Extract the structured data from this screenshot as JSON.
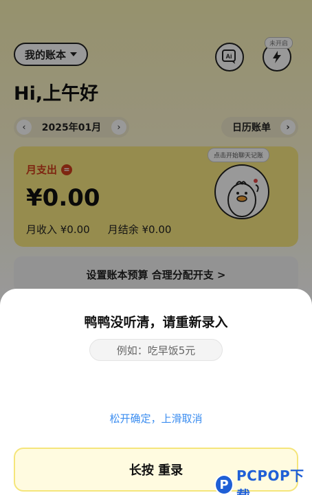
{
  "header": {
    "account_label": "我的账本",
    "ai_icon": "ai-icon",
    "bolt_icon": "bolt-icon",
    "bolt_tag": "未开启",
    "greeting": "Hi,上午好"
  },
  "month_nav": {
    "prev": "‹",
    "month": "2025年01月",
    "next": "›",
    "calendar_label": "日历账单",
    "calendar_arrow": "›"
  },
  "summary": {
    "spend_label": "月支出",
    "spend_icon": "=",
    "amount": "¥0.00",
    "income": "月收入 ¥0.00",
    "balance": "月结余 ¥0.00",
    "duck_bubble": "点击开始聊天记账"
  },
  "budget": {
    "label": "设置账本预算 合理分配开支 >"
  },
  "sheet": {
    "title": "鸭鸭没听清，请重新录入",
    "example": "例如：吃早饭5元",
    "hint": "松开确定，上滑取消",
    "hold_button": "长按 重录"
  },
  "watermark": {
    "logo_letter": "P",
    "text": "PCPOP下载"
  },
  "colors": {
    "accent_yellow": "#fbe983",
    "spend_red": "#d2401d",
    "hint_blue": "#3b8df0"
  }
}
